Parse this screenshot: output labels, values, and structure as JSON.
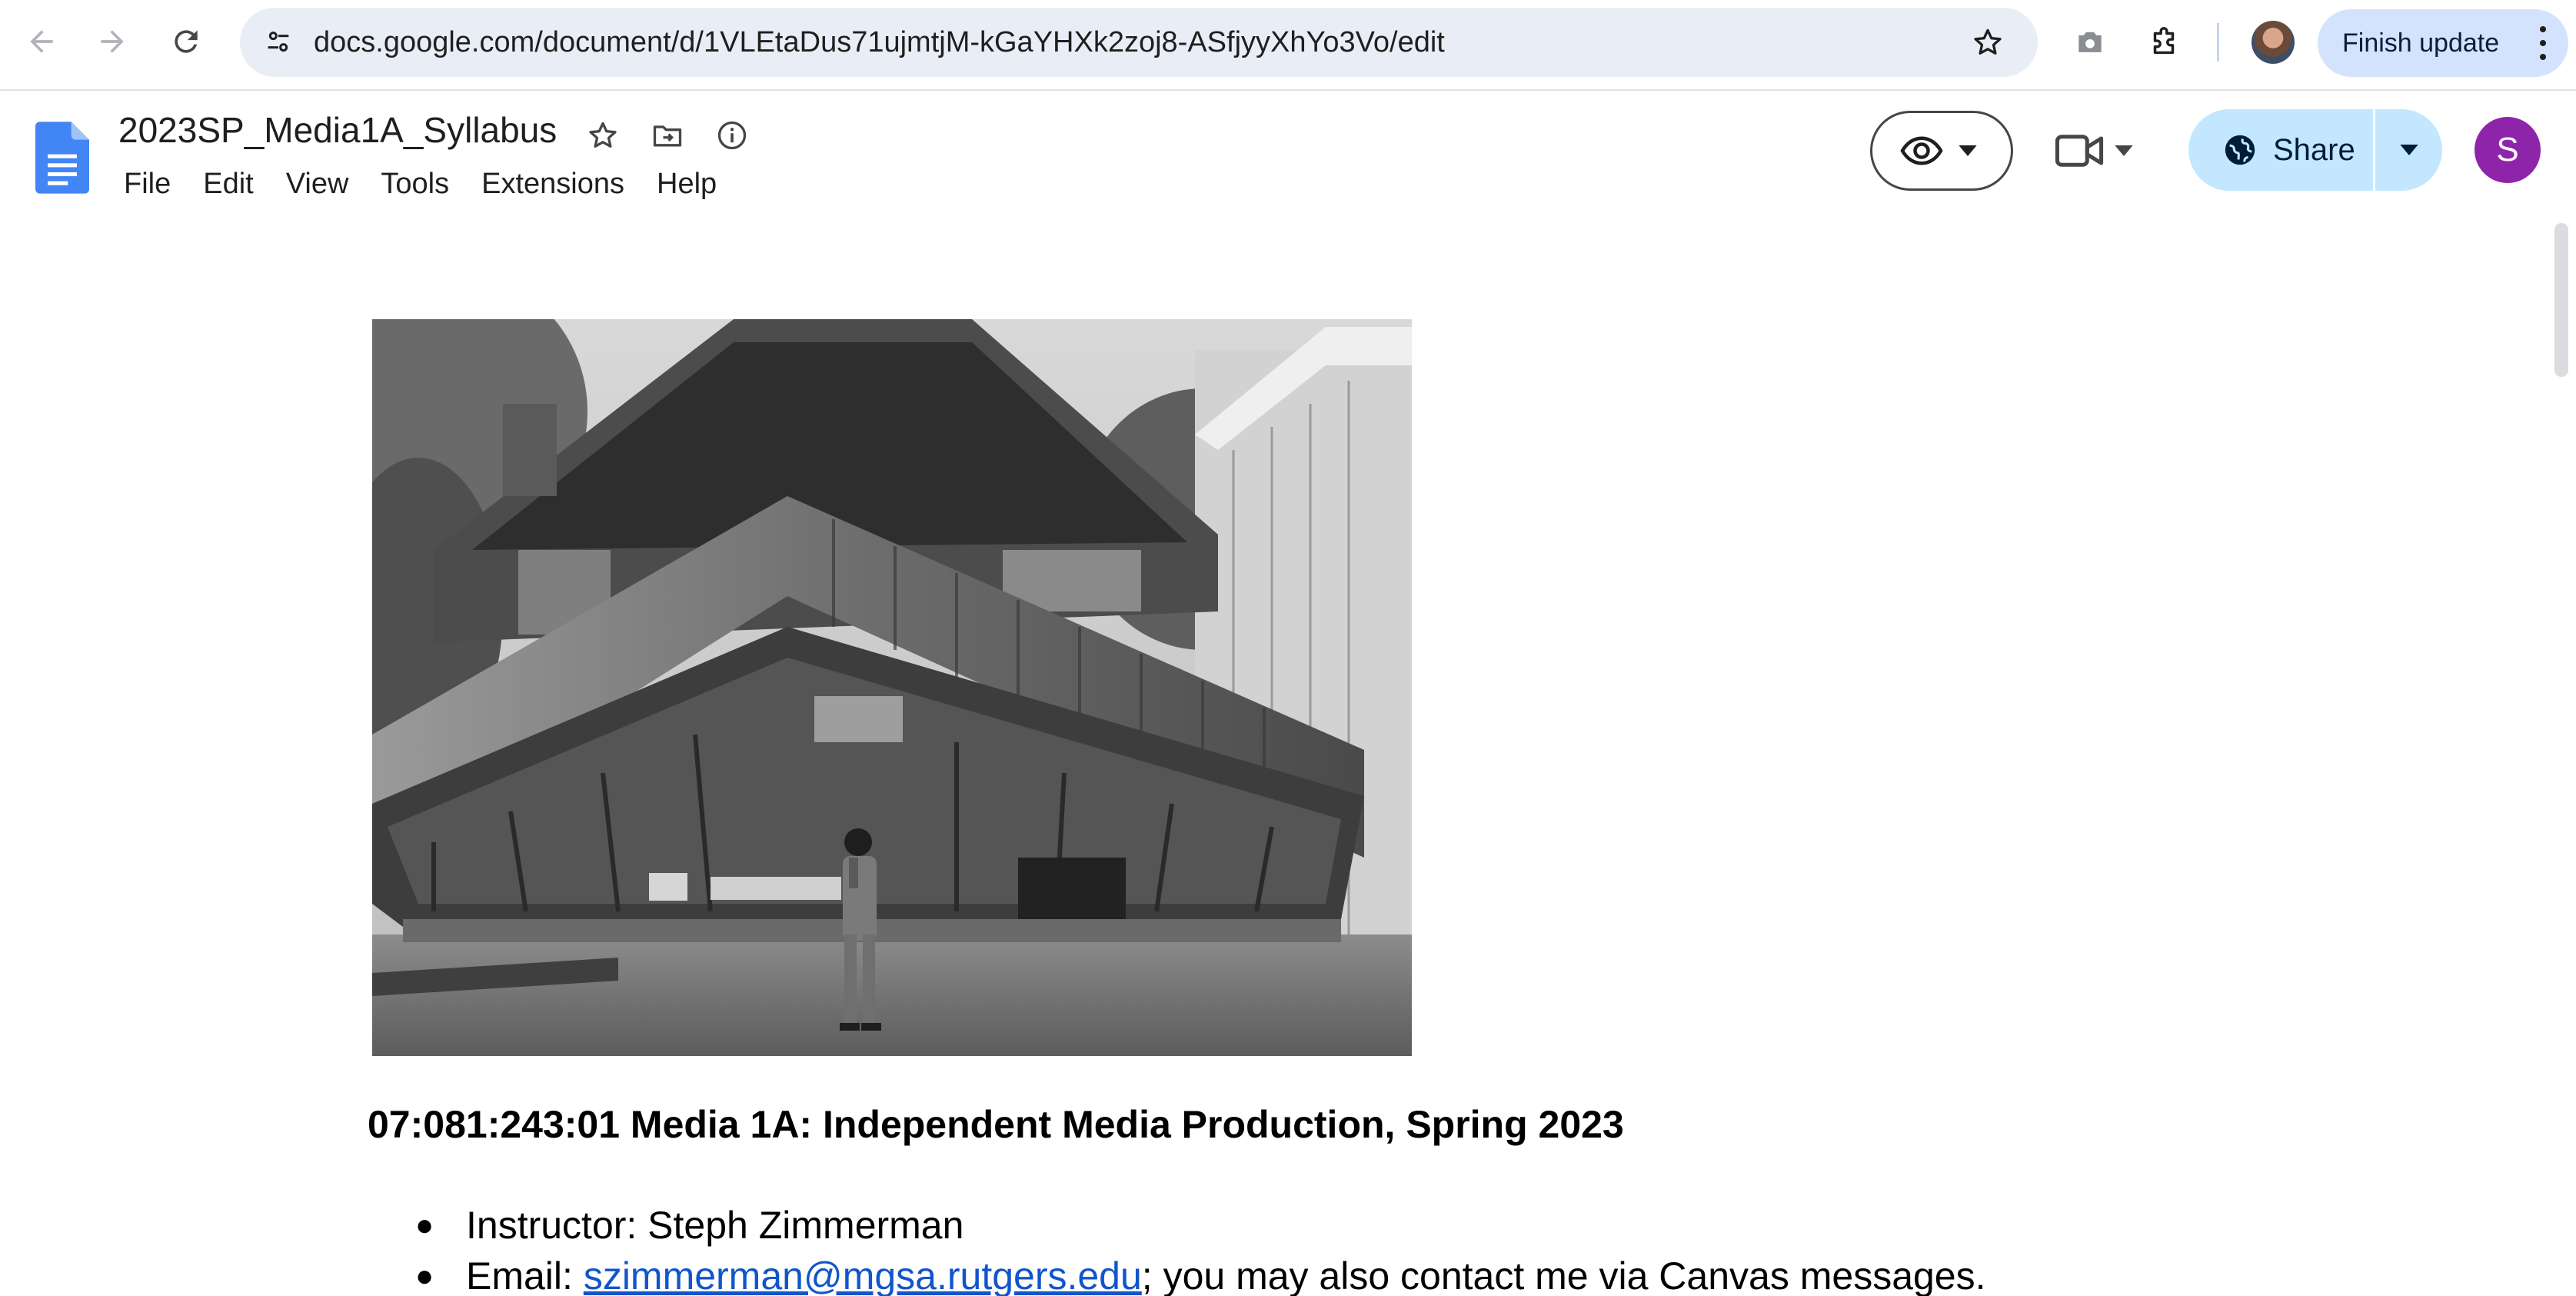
{
  "browser": {
    "url": "docs.google.com/document/d/1VLEtaDus71ujmtjM-kGaYHXk2zoj8-ASfjyyXhYo3Vo/edit",
    "update_button_label": "Finish update",
    "icons": {
      "back": "arrow-left-icon",
      "forward": "arrow-right-icon",
      "reload": "reload-icon",
      "site_info": "tune-icon",
      "bookmark": "star-outline-icon",
      "screenshot": "camera-icon",
      "extensions": "puzzle-icon",
      "profile": "profile-photo",
      "menu": "vertical-dots-icon"
    }
  },
  "docs": {
    "title": "2023SP_Media1A_Syllabus",
    "menu": [
      "File",
      "Edit",
      "View",
      "Tools",
      "Extensions",
      "Help"
    ],
    "share_label": "Share",
    "account_initial": "S",
    "icons": {
      "logo": "google-docs-icon",
      "star": "star-outline-icon",
      "move": "folder-move-icon",
      "details": "info-icon",
      "mode": "eye-icon",
      "meet": "video-camera-icon",
      "share": "globe-icon"
    },
    "colors": {
      "share_button_bg": "#c2e7ff",
      "avatar_bg": "#8e24aa",
      "link": "#1155cc"
    }
  },
  "document": {
    "image": "black-and-white photograph of an upside-down house with a man standing in front",
    "heading": "07:081:243:01 Media 1A: Independent Media Production, Spring 2023",
    "bullets": {
      "instructor": "Instructor: Steph Zimmerman",
      "email_prefix": "Email: ",
      "email_link": "szimmerman@mgsa.rutgers.edu",
      "email_suffix": "; you may also contact me via Canvas messages."
    },
    "bullet_char": "●"
  }
}
